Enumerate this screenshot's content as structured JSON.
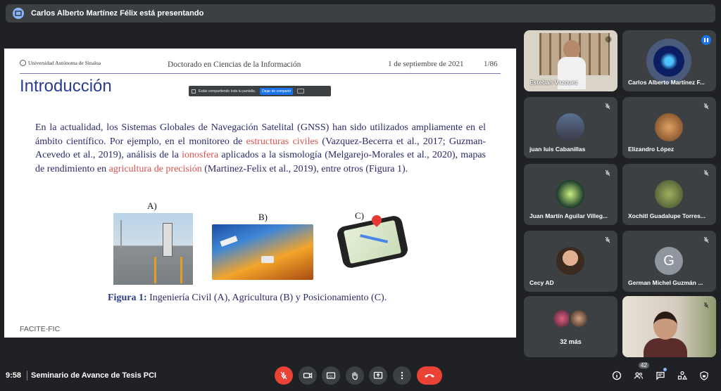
{
  "banner": {
    "text": "Carlos Alberto Martínez Félix está presentando"
  },
  "slide": {
    "institution": "Universidad Autónoma de Sinaloa",
    "header_title": "Doctorado en Ciencias de la Información",
    "date": "1 de septiembre de 2021",
    "page": "1/86",
    "title": "Introducción",
    "body_1": "En la actualidad, los Sistemas Globales de Navegación Satelital (GNSS) han sido utilizados ampliamente en el ámbito científico. Por ejemplo, en el monitoreo de ",
    "body_red_1": "estructuras civiles",
    "body_2": " (Vazquez-Becerra et al., 2017; Guzman-Acevedo et al., 2019), análisis de la ",
    "body_red_2": "ionosfera",
    "body_3": " aplicados a la sismología (Melgarejo-Morales et al., 2020), mapas de rendimiento en ",
    "body_red_3": "agricultura de precisión",
    "body_4": " (Martinez-Felix et al., 2019), entre otros (Figura 1).",
    "fig_a": "A)",
    "fig_b": "B)",
    "fig_c": "C)",
    "caption_label": "Figura 1:",
    "caption_text": " Ingeniería Civil (A), Agricultura (B) y Posicionamiento (C).",
    "footer": "FACITE-FIC",
    "share_text": "Estás compartiendo toda tu pantalla.",
    "share_stop": "Dejar de compartir"
  },
  "participants": [
    {
      "name": "Esteban Vazquez"
    },
    {
      "name": "Carlos Alberto Martínez F..."
    },
    {
      "name": "juan luis Cabanillas"
    },
    {
      "name": "Elizandro López"
    },
    {
      "name": "Juan Martín Aguilar Villeg..."
    },
    {
      "name": "Xochitl Guadalupe Torres..."
    },
    {
      "name": "Cecy AD"
    },
    {
      "name": "German Michel Guzmán ...",
      "initial": "G"
    },
    {
      "name": "32 más"
    }
  ],
  "bottom": {
    "time": "9:58",
    "meeting": "Seminario de Avance de Tesis PCI",
    "people_count": "42"
  },
  "colors": {
    "background": "#202124",
    "tile": "#3c4043",
    "danger": "#ea4335",
    "accent": "#1a73e8"
  }
}
